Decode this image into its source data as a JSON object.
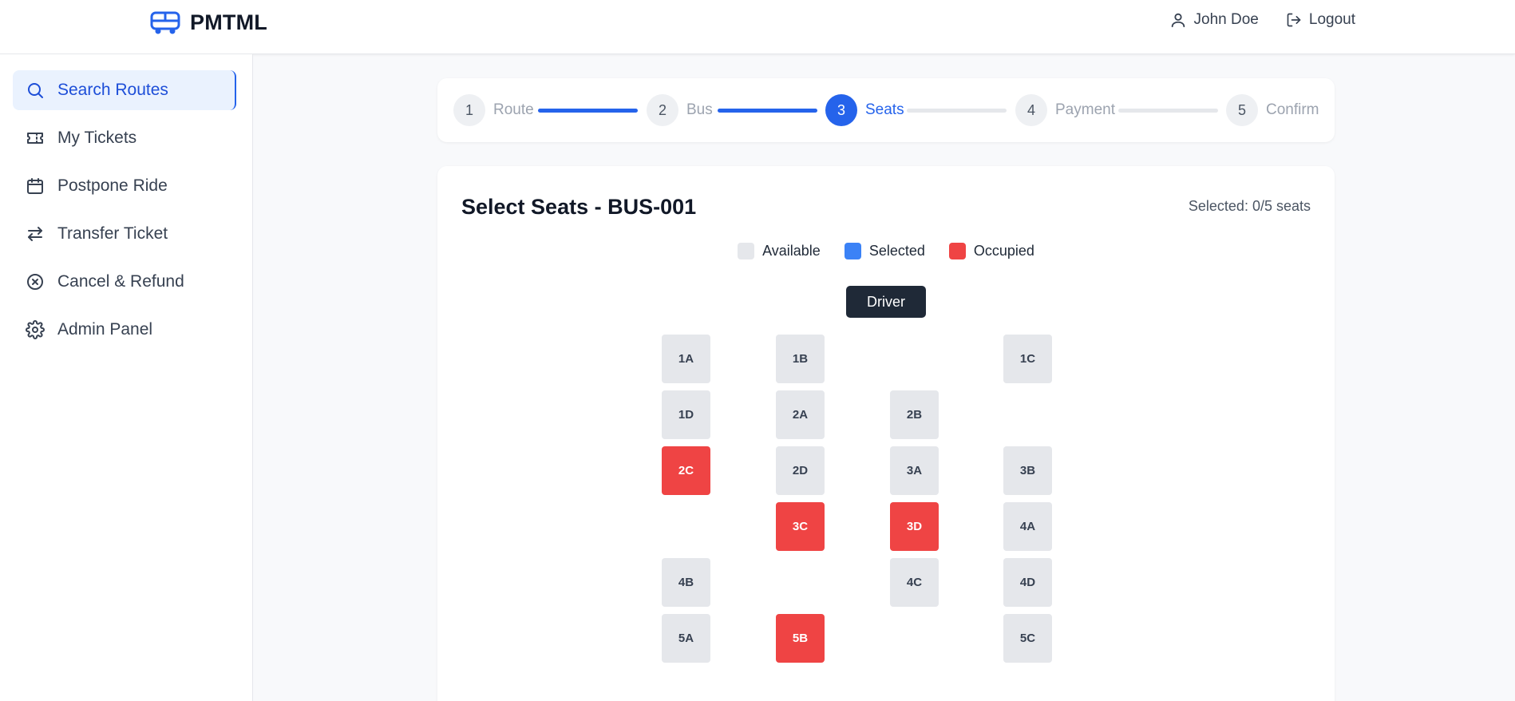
{
  "header": {
    "brand": "PMTML",
    "brand_icon": "bus-icon",
    "user_name": "John Doe",
    "logout_label": "Logout"
  },
  "sidebar": {
    "items": [
      {
        "label": "Search Routes",
        "icon": "search-icon",
        "active": true
      },
      {
        "label": "My Tickets",
        "icon": "ticket-icon"
      },
      {
        "label": "Postpone Ride",
        "icon": "calendar-icon"
      },
      {
        "label": "Transfer Ticket",
        "icon": "transfer-icon"
      },
      {
        "label": "Cancel & Refund",
        "icon": "cancel-icon"
      },
      {
        "label": "Admin Panel",
        "icon": "gear-icon"
      }
    ]
  },
  "stepper": {
    "steps": [
      {
        "number": "1",
        "label": "Route"
      },
      {
        "number": "2",
        "label": "Bus"
      },
      {
        "number": "3",
        "label": "Seats"
      },
      {
        "number": "4",
        "label": "Payment"
      },
      {
        "number": "5",
        "label": "Confirm"
      }
    ],
    "current_step": 3
  },
  "seat_selection": {
    "title": "Select Seats - BUS-001",
    "selected_status": "Selected: 0/5 seats",
    "legend": [
      {
        "label": "Available",
        "color": "#e5e7eb"
      },
      {
        "label": "Selected",
        "color": "#3b82f6"
      },
      {
        "label": "Occupied",
        "color": "#ef4444"
      }
    ],
    "driver_label": "Driver",
    "seats": [
      {
        "id": "1A",
        "status": "available"
      },
      {
        "id": "1B",
        "status": "available"
      },
      {
        "id": "1C",
        "status": "available"
      },
      {
        "id": "1D",
        "status": "available"
      },
      {
        "id": "2A",
        "status": "available"
      },
      {
        "id": "2B",
        "status": "available"
      },
      {
        "id": "2C",
        "status": "occupied"
      },
      {
        "id": "2D",
        "status": "available"
      },
      {
        "id": "3A",
        "status": "available"
      },
      {
        "id": "3B",
        "status": "available"
      },
      {
        "id": "3C",
        "status": "occupied"
      },
      {
        "id": "3D",
        "status": "occupied"
      },
      {
        "id": "4A",
        "status": "available"
      },
      {
        "id": "4B",
        "status": "available"
      },
      {
        "id": "4C",
        "status": "available"
      },
      {
        "id": "4D",
        "status": "available"
      },
      {
        "id": "5A",
        "status": "available"
      },
      {
        "id": "5B",
        "status": "occupied"
      },
      {
        "id": "5C",
        "status": "available"
      }
    ]
  },
  "colors": {
    "accent": "#2563eb",
    "available": "#e5e7eb",
    "selected": "#3b82f6",
    "occupied": "#ef4444"
  }
}
